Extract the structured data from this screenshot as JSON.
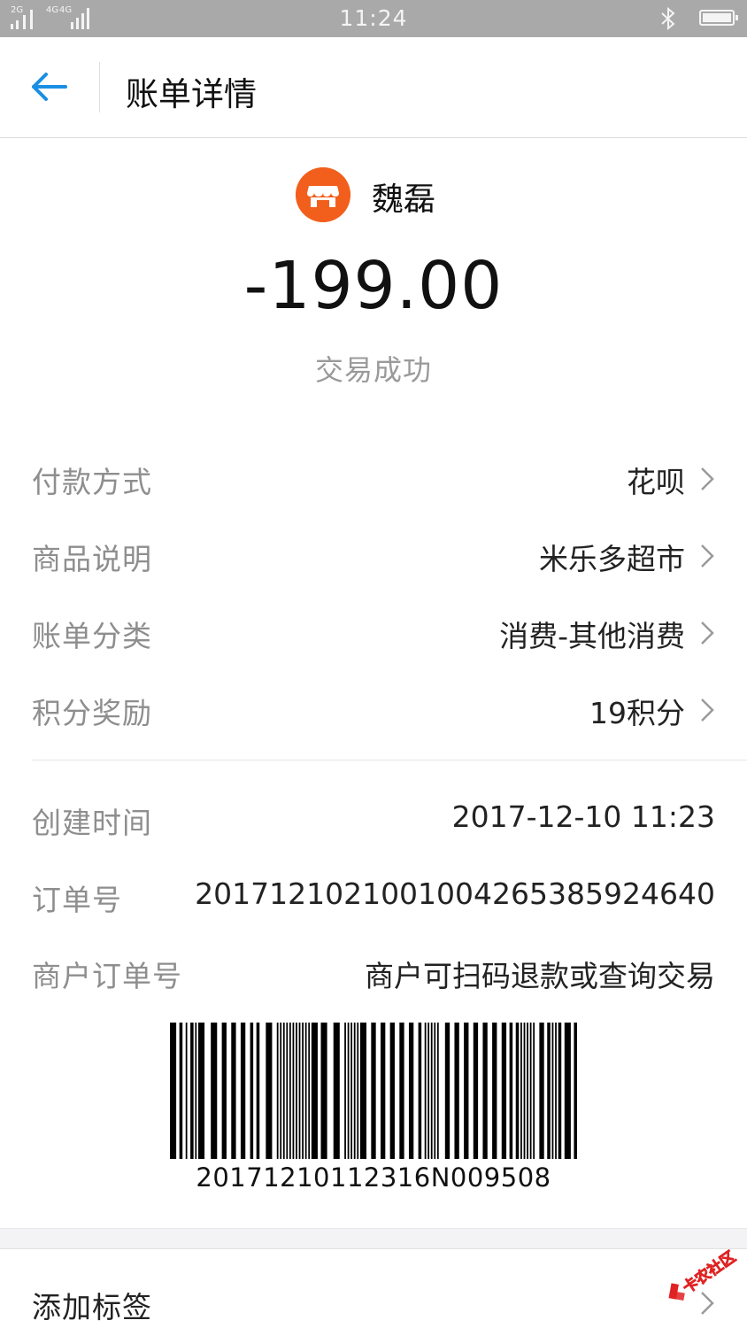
{
  "status_bar": {
    "network_1": "2G",
    "network_2": "4G",
    "network_3": "4G",
    "time": "11:24",
    "icons": [
      "signal-icon",
      "bluetooth-icon",
      "battery-icon"
    ]
  },
  "header": {
    "title": "账单详情",
    "back_icon": "arrow-left-icon",
    "accent_color": "#1a8fe3"
  },
  "merchant": {
    "name": "魏磊",
    "icon": "shop-icon",
    "icon_color": "#f25f1c"
  },
  "transaction": {
    "amount": "-199.00",
    "status": "交易成功"
  },
  "details": [
    {
      "label": "付款方式",
      "value": "花呗"
    },
    {
      "label": "商品说明",
      "value": "米乐多超市"
    },
    {
      "label": "账单分类",
      "value": "消费-其他消费"
    },
    {
      "label": "积分奖励",
      "value": "19积分"
    }
  ],
  "info": [
    {
      "label": "创建时间",
      "value": "2017-12-10 11:23"
    },
    {
      "label": "订单号",
      "value": "2017121021001004265385924640"
    },
    {
      "label": "商户订单号",
      "value": "商户可扫码退款或查询交易"
    }
  ],
  "barcode": {
    "text": "20171210112316N009508"
  },
  "footer": {
    "add_tag": "添加标签"
  },
  "watermark": {
    "text": "卡农社区"
  }
}
